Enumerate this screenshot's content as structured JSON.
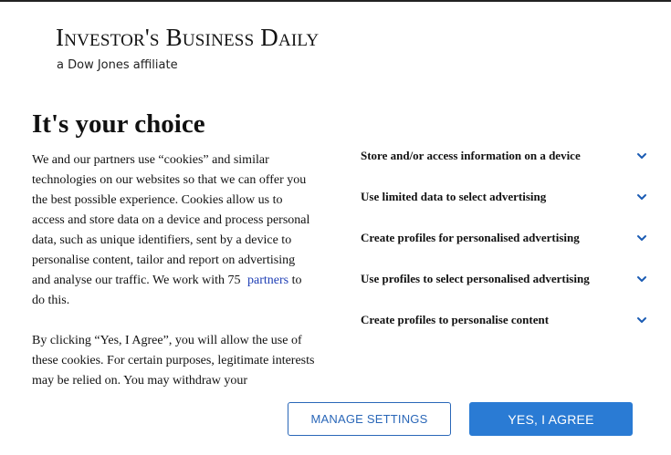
{
  "logo": {
    "title": "Investor's Business Daily",
    "subtitle": "a Dow Jones affiliate"
  },
  "heading": "It's your choice",
  "body": {
    "p1_before_link": "We and our partners use “cookies” and similar technologies on our websites so that we can offer you the best possible experience. Cookies allow us to access and store data on a device and process personal data, such as unique identifiers, sent by a device to personalise content, tailor and report on advertising and analyse our traffic. We work with 75 ",
    "partners_link": "partners",
    "p1_after_link": " to do this.",
    "p2": "By clicking “Yes, I Agree”, you will allow the use of these cookies. For certain purposes, legitimate interests may be relied on. You may withdraw your"
  },
  "purposes": [
    {
      "label": "Store and/or access information on a device",
      "icon": "chevron-down-icon"
    },
    {
      "label": "Use limited data to select advertising",
      "icon": "chevron-down-icon"
    },
    {
      "label": "Create profiles for personalised advertising",
      "icon": "chevron-down-icon"
    },
    {
      "label": "Use profiles to select personalised advertising",
      "icon": "chevron-down-icon"
    },
    {
      "label": "Create profiles to personalise content",
      "icon": "chevron-down-icon"
    }
  ],
  "buttons": {
    "manage_label": "MANAGE SETTINGS",
    "agree_label": "YES, I AGREE"
  },
  "colors": {
    "accent": "#2a7bd4",
    "link": "#1f3fb5",
    "outline_button": "#2a67b8"
  }
}
